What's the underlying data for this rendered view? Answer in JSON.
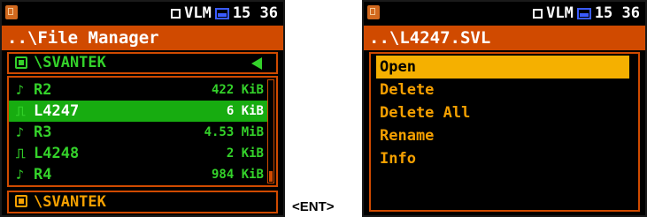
{
  "left_screen": {
    "status": {
      "mode": "VLM",
      "time": "15 36"
    },
    "title": "..\\File Manager",
    "folder_header": "\\SVANTEK",
    "files": [
      {
        "icon": "note-icon",
        "glyph": "♪",
        "name": "R2",
        "size": "422 KiB",
        "selected": false
      },
      {
        "icon": "waveform-icon",
        "glyph": "⎍",
        "name": "L4247",
        "size": "6 KiB",
        "selected": true
      },
      {
        "icon": "note-icon",
        "glyph": "♪",
        "name": "R3",
        "size": "4.53 MiB",
        "selected": false
      },
      {
        "icon": "waveform-icon",
        "glyph": "⎍",
        "name": "L4248",
        "size": "2 KiB",
        "selected": false
      },
      {
        "icon": "note-icon",
        "glyph": "♪",
        "name": "R4",
        "size": "984 KiB",
        "selected": false
      }
    ],
    "bottom_path": "\\SVANTEK"
  },
  "key_label": "<ENT>",
  "right_screen": {
    "status": {
      "mode": "VLM",
      "time": "15 36"
    },
    "title": "..\\L4247.SVL",
    "menu": [
      {
        "label": "Open",
        "selected": true
      },
      {
        "label": "Delete",
        "selected": false
      },
      {
        "label": "Delete All",
        "selected": false
      },
      {
        "label": "Rename",
        "selected": false
      },
      {
        "label": "Info",
        "selected": false
      }
    ]
  },
  "colors": {
    "title_bar": "#d04a00",
    "file_green": "#34d22a",
    "selected_green": "#17ac10",
    "menu_orange": "#f5a000",
    "menu_selected": "#f5b000",
    "battery_blue": "#3a5bff"
  }
}
